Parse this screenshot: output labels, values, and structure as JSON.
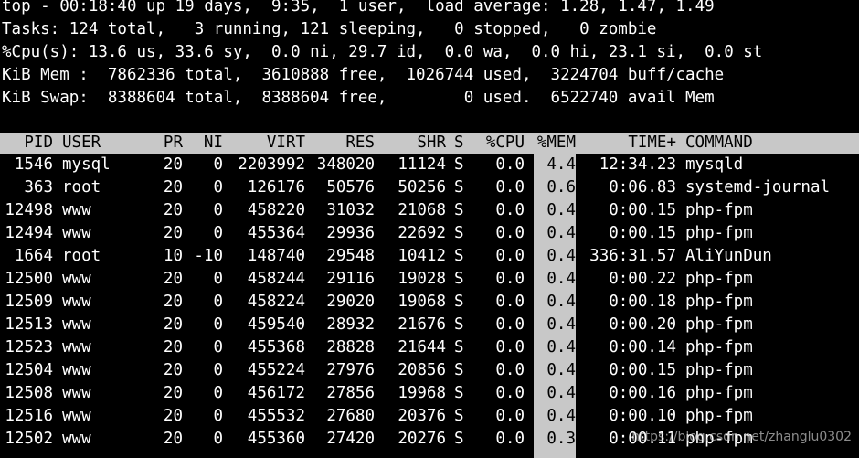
{
  "summary": {
    "line_top": "top - 00:18:40 up 19 days,  9:35,  1 user,  load average: 1.28, 1.47, 1.49",
    "line_tasks": "Tasks: 124 total,   3 running, 121 sleeping,   0 stopped,   0 zombie",
    "line_cpu": "%Cpu(s): 13.6 us, 33.6 sy,  0.0 ni, 29.7 id,  0.0 wa,  0.0 hi, 23.1 si,  0.0 st",
    "line_mem": "KiB Mem :  7862336 total,  3610888 free,  1026744 used,  3224704 buff/cache",
    "line_swap": "KiB Swap:  8388604 total,  8388604 free,        0 used.  6522740 avail Mem"
  },
  "columns": {
    "pid": "PID",
    "user": "USER",
    "pr": "PR",
    "ni": "NI",
    "virt": "VIRT",
    "res": "RES",
    "shr": "SHR",
    "s": "S",
    "cpu": "%CPU",
    "mem": "%MEM",
    "time": "TIME+",
    "command": "COMMAND"
  },
  "processes": [
    {
      "pid": "1546",
      "user": "mysql",
      "pr": "20",
      "ni": "0",
      "virt": "2203992",
      "res": "348020",
      "shr": "11124",
      "s": "S",
      "cpu": "0.0",
      "mem": "4.4",
      "time": "12:34.23",
      "command": "mysqld"
    },
    {
      "pid": "363",
      "user": "root",
      "pr": "20",
      "ni": "0",
      "virt": "126176",
      "res": "50576",
      "shr": "50256",
      "s": "S",
      "cpu": "0.0",
      "mem": "0.6",
      "time": "0:06.83",
      "command": "systemd-journal"
    },
    {
      "pid": "12498",
      "user": "www",
      "pr": "20",
      "ni": "0",
      "virt": "458220",
      "res": "31032",
      "shr": "21068",
      "s": "S",
      "cpu": "0.0",
      "mem": "0.4",
      "time": "0:00.15",
      "command": "php-fpm"
    },
    {
      "pid": "12494",
      "user": "www",
      "pr": "20",
      "ni": "0",
      "virt": "455364",
      "res": "29936",
      "shr": "22692",
      "s": "S",
      "cpu": "0.0",
      "mem": "0.4",
      "time": "0:00.15",
      "command": "php-fpm"
    },
    {
      "pid": "1664",
      "user": "root",
      "pr": "10",
      "ni": "-10",
      "virt": "148740",
      "res": "29548",
      "shr": "10412",
      "s": "S",
      "cpu": "0.0",
      "mem": "0.4",
      "time": "336:31.57",
      "command": "AliYunDun"
    },
    {
      "pid": "12500",
      "user": "www",
      "pr": "20",
      "ni": "0",
      "virt": "458244",
      "res": "29116",
      "shr": "19028",
      "s": "S",
      "cpu": "0.0",
      "mem": "0.4",
      "time": "0:00.22",
      "command": "php-fpm"
    },
    {
      "pid": "12509",
      "user": "www",
      "pr": "20",
      "ni": "0",
      "virt": "458224",
      "res": "29020",
      "shr": "19068",
      "s": "S",
      "cpu": "0.0",
      "mem": "0.4",
      "time": "0:00.18",
      "command": "php-fpm"
    },
    {
      "pid": "12513",
      "user": "www",
      "pr": "20",
      "ni": "0",
      "virt": "459540",
      "res": "28932",
      "shr": "21676",
      "s": "S",
      "cpu": "0.0",
      "mem": "0.4",
      "time": "0:00.20",
      "command": "php-fpm"
    },
    {
      "pid": "12523",
      "user": "www",
      "pr": "20",
      "ni": "0",
      "virt": "455368",
      "res": "28828",
      "shr": "21644",
      "s": "S",
      "cpu": "0.0",
      "mem": "0.4",
      "time": "0:00.14",
      "command": "php-fpm"
    },
    {
      "pid": "12504",
      "user": "www",
      "pr": "20",
      "ni": "0",
      "virt": "455224",
      "res": "27976",
      "shr": "20856",
      "s": "S",
      "cpu": "0.0",
      "mem": "0.4",
      "time": "0:00.15",
      "command": "php-fpm"
    },
    {
      "pid": "12508",
      "user": "www",
      "pr": "20",
      "ni": "0",
      "virt": "456172",
      "res": "27856",
      "shr": "19968",
      "s": "S",
      "cpu": "0.0",
      "mem": "0.4",
      "time": "0:00.16",
      "command": "php-fpm"
    },
    {
      "pid": "12516",
      "user": "www",
      "pr": "20",
      "ni": "0",
      "virt": "455532",
      "res": "27680",
      "shr": "20376",
      "s": "S",
      "cpu": "0.0",
      "mem": "0.4",
      "time": "0:00.10",
      "command": "php-fpm"
    },
    {
      "pid": "12502",
      "user": "www",
      "pr": "20",
      "ni": "0",
      "virt": "455360",
      "res": "27420",
      "shr": "20276",
      "s": "S",
      "cpu": "0.0",
      "mem": "0.3",
      "time": "0:00.11",
      "command": "php-fpm"
    }
  ],
  "watermark": "https://blog.csdn.net/zhanglu0302",
  "colors": {
    "background": "#000000",
    "foreground": "#ffffff",
    "header_bar": "#c8c8c8"
  }
}
